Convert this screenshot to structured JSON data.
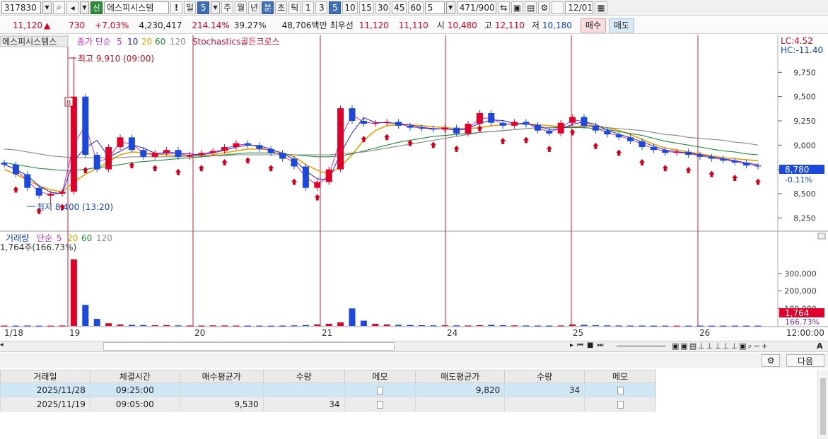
{
  "toolbar": {
    "code": "317830",
    "badge": "신",
    "name": "에스피시스템",
    "excl": "!",
    "period_day": "일",
    "period_num": "5",
    "week": "주",
    "month": "월",
    "year": "년",
    "minute": "분",
    "second": "초",
    "tick": "틱",
    "intervals": [
      "1",
      "3",
      "5",
      "10",
      "15",
      "30",
      "45",
      "60"
    ],
    "count": "5",
    "range": "471",
    "range_total": "/900",
    "date": "12/01"
  },
  "quote": {
    "price": "11,120",
    "change": "730",
    "rate": "+7.03%",
    "volume": "4,230,417",
    "vol_ratio": "214.14%",
    "turnover_pct": "39.27%",
    "amount": "48,706백만",
    "best_label": "최우선",
    "best_ask": "11,120",
    "best_bid": "11,110",
    "open_label": "시",
    "open": "10,480",
    "high_label": "고",
    "high": "12,110",
    "low_label": "저",
    "low": "10,180",
    "buy_btn": "매수",
    "sell_btn": "매도"
  },
  "chart": {
    "stock_tab": "에스피시스템스",
    "ma_label": "종가 단순",
    "ma_periods": [
      "5",
      "10",
      "20",
      "60",
      "120"
    ],
    "signal_label": "Stochastics골든크로스",
    "lc": "LC:4.52",
    "hc": "HC:-11.40",
    "annot_high": "최고 9,910 (09:00)",
    "annot_low": "최저 8,400 (13:20)",
    "current_price": "8,780",
    "current_change": "-0.11%",
    "vol_label": "거래량",
    "vol_ma_label": "단순",
    "vol_ma_periods": [
      "5",
      "20",
      "60",
      "120"
    ],
    "vol_info": "1,764주(166.73%)",
    "vol_current": "1,764",
    "vol_ratio": "166.73%",
    "time_last": "12:00:00",
    "buy_marker": "B",
    "colors": {
      "up": "#e0002a",
      "down": "#1c49d9",
      "ma5": "#c030c0",
      "ma10": "#2020d0",
      "ma20": "#e8a000",
      "ma60": "#1f8a3a",
      "ma120": "#888888"
    }
  },
  "chart_data": {
    "type": "line",
    "title": "",
    "xlabel": "",
    "ylabel": "",
    "x_ticks": [
      "1/18",
      "19",
      "20",
      "21",
      "24",
      "25",
      "26"
    ],
    "y_ticks": [
      9750,
      9500,
      9250,
      9000,
      8750,
      8500,
      8250
    ],
    "ylim": [
      8150,
      10000
    ],
    "vol_ticks": [
      300000,
      200000,
      100000
    ],
    "vol_ylim": [
      0,
      400000
    ],
    "series": [
      {
        "name": "종가",
        "values": [
          8800,
          8700,
          8560,
          8480,
          8500,
          8520,
          9500,
          8900,
          8750,
          8980,
          9080,
          8950,
          8880,
          8920,
          8950,
          8880,
          8900,
          8920,
          8940,
          8980,
          9020,
          9000,
          8960,
          8920,
          8860,
          8780,
          8560,
          8620,
          8750,
          9380,
          9250,
          9220,
          9230,
          9240,
          9200,
          9180,
          9170,
          9160,
          9180,
          9120,
          9220,
          9330,
          9230,
          9200,
          9240,
          9210,
          9150,
          9120,
          9230,
          9290,
          9200,
          9150,
          9110,
          9080,
          9040,
          8980,
          8950,
          8920,
          8930,
          8900,
          8880,
          8860,
          8840,
          8820,
          8790,
          8780
        ]
      },
      {
        "name": "20",
        "values": [
          8750,
          8700,
          8640,
          8580,
          8540,
          8520,
          8620,
          8700,
          8760,
          8830,
          8900,
          8930,
          8920,
          8910,
          8900,
          8890,
          8890,
          8890,
          8900,
          8920,
          8940,
          8960,
          8960,
          8950,
          8920,
          8880,
          8800,
          8740,
          8700,
          8780,
          8900,
          9050,
          9150,
          9200,
          9210,
          9210,
          9200,
          9190,
          9180,
          9170,
          9170,
          9180,
          9200,
          9210,
          9220,
          9220,
          9210,
          9200,
          9190,
          9190,
          9200,
          9200,
          9180,
          9150,
          9110,
          9060,
          9010,
          8970,
          8950,
          8930,
          8910,
          8890,
          8870,
          8860,
          8850,
          8840
        ]
      },
      {
        "name": "60",
        "values": [
          8820,
          8800,
          8780,
          8760,
          8750,
          8740,
          8740,
          8750,
          8770,
          8780,
          8800,
          8820,
          8830,
          8840,
          8850,
          8860,
          8870,
          8880,
          8890,
          8900,
          8910,
          8920,
          8920,
          8920,
          8910,
          8900,
          8890,
          8880,
          8880,
          8890,
          8910,
          8940,
          8970,
          9000,
          9030,
          9050,
          9070,
          9090,
          9100,
          9110,
          9120,
          9130,
          9140,
          9150,
          9160,
          9170,
          9180,
          9180,
          9180,
          9180,
          9180,
          9170,
          9160,
          9140,
          9120,
          9100,
          9070,
          9040,
          9020,
          9000,
          8980,
          8960,
          8940,
          8930,
          8910,
          8900
        ]
      },
      {
        "name": "120",
        "values": [
          8960,
          8950,
          8930,
          8910,
          8890,
          8880,
          8870,
          8870,
          8870,
          8870,
          8870,
          8880,
          8880,
          8880,
          8880,
          8880,
          8890,
          8890,
          8890,
          8890,
          8900,
          8900,
          8900,
          8900,
          8900,
          8900,
          8900,
          8900,
          8900,
          8910,
          8920,
          8930,
          8950,
          8970,
          8990,
          9010,
          9030,
          9050,
          9070,
          9090,
          9110,
          9130,
          9140,
          9150,
          9160,
          9170,
          9180,
          9180,
          9190,
          9190,
          9190,
          9190,
          9180,
          9170,
          9160,
          9150,
          9130,
          9110,
          9100,
          9080,
          9070,
          9060,
          9050,
          9030,
          9020,
          9000
        ]
      }
    ],
    "volume": [
      2000,
      1800,
      2200,
      1500,
      1600,
      2500,
      380000,
      120000,
      40000,
      15000,
      8000,
      6000,
      5000,
      4000,
      5000,
      3000,
      2500,
      2000,
      3000,
      2500,
      2000,
      2000,
      1800,
      1500,
      2000,
      3000,
      5000,
      8000,
      12000,
      20000,
      100000,
      30000,
      12000,
      8000,
      6000,
      5000,
      4000,
      3000,
      3500,
      3000,
      2500,
      4000,
      6000,
      4000,
      3000,
      2500,
      2000,
      2000,
      2500,
      8000,
      6000,
      4000,
      3000,
      2500,
      2000,
      2000,
      1800,
      1500,
      1500,
      1800,
      2000,
      1500,
      1500,
      1800,
      1764,
      1764
    ]
  },
  "table": {
    "settings_icon": "gear-icon",
    "next_btn": "다음",
    "headers": [
      "거래일",
      "체결시간",
      "매수평균가",
      "수량",
      "메모",
      "매도평균가",
      "수량",
      "메모"
    ],
    "rows": [
      [
        "2025/11/28",
        "09:25:00",
        "",
        "",
        "",
        "9,820",
        "34",
        ""
      ],
      [
        "2025/11/19",
        "09:05:00",
        "9,530",
        "34",
        "",
        "",
        "",
        ""
      ]
    ]
  }
}
